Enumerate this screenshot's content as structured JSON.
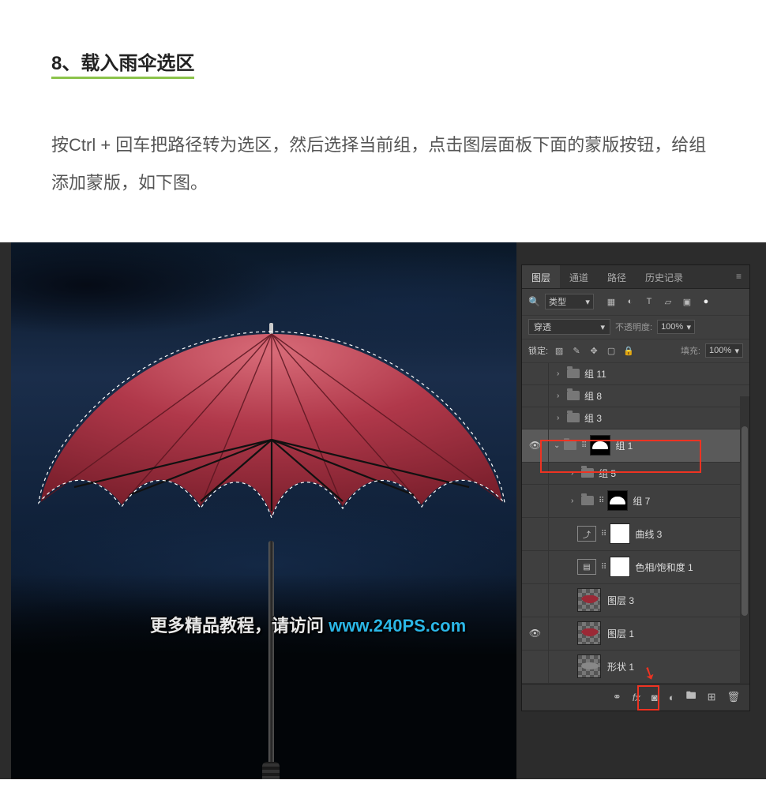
{
  "article": {
    "step_title": "8、载入雨伞选区",
    "step_description": "按Ctrl + 回车把路径转为选区，然后选择当前组，点击图层面板下面的蒙版按钮，给组添加蒙版，如下图。"
  },
  "watermark": {
    "text_cn": "更多精品教程，请访问 ",
    "url": "www.240PS.com"
  },
  "panel": {
    "tabs": {
      "layers": "图层",
      "channels": "通道",
      "paths": "路径",
      "history": "历史记录"
    },
    "filter_type": "类型",
    "blend_mode": "穿透",
    "opacity_label": "不透明度:",
    "opacity_value": "100%",
    "lock_label": "锁定:",
    "fill_label": "填充:",
    "fill_value": "100%",
    "layers": {
      "g11": "组 11",
      "g8": "组 8",
      "g3_top": "组 3",
      "g1": "组 1",
      "g5": "组 5",
      "g7": "组 7",
      "curves3": "曲线 3",
      "huesat1": "色相/饱和度 1",
      "layer3": "图层 3",
      "layer1": "图层 1",
      "shape1": "形状 1"
    },
    "footer_icons": {
      "link": "link-icon",
      "fx": "fx-icon",
      "mask": "add-mask-icon",
      "adj": "adjustment-icon",
      "group": "group-icon",
      "new": "new-layer-icon",
      "trash": "trash-icon"
    }
  }
}
